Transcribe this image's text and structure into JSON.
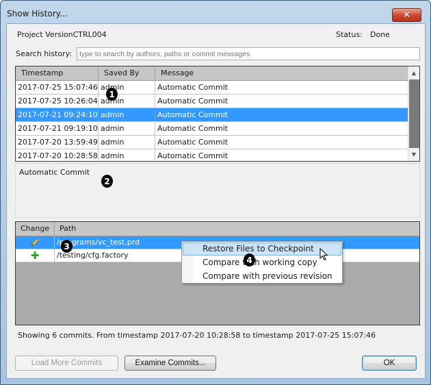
{
  "window": {
    "title": "Show History...",
    "close_icon": "close-x-icon"
  },
  "header": {
    "project": "Project VersionCTRL004",
    "status_label": "Status:",
    "status_value": "Done"
  },
  "search": {
    "label": "Search history:",
    "placeholder": "type to search by authors, paths or commit messages",
    "value": ""
  },
  "commits": {
    "columns": [
      "Timestamp",
      "Saved By",
      "Message"
    ],
    "selected_index": 2,
    "rows": [
      {
        "timestamp": "2017-07-25 15:07:46",
        "saved_by": "admin",
        "message": "Automatic Commit"
      },
      {
        "timestamp": "2017-07-25 10:26:04",
        "saved_by": "admin",
        "message": "Automatic Commit"
      },
      {
        "timestamp": "2017-07-21 09:24:10",
        "saved_by": "admin",
        "message": "Automatic Commit"
      },
      {
        "timestamp": "2017-07-21 09:19:10",
        "saved_by": "admin",
        "message": "Automatic Commit"
      },
      {
        "timestamp": "2017-07-20 13:59:49",
        "saved_by": "admin",
        "message": "Automatic Commit"
      },
      {
        "timestamp": "2017-07-20 10:28:58",
        "saved_by": "admin",
        "message": "Automatic Commit"
      }
    ]
  },
  "detail": {
    "message": "Automatic Commit"
  },
  "files": {
    "columns": [
      "Change",
      "Path"
    ],
    "selected_index": 0,
    "rows": [
      {
        "change": "modified",
        "change_icon": "pencil-icon",
        "path": "/programs/vc_test.prd"
      },
      {
        "change": "added",
        "change_icon": "plus-icon",
        "path": "/testing/cfg.factory"
      }
    ]
  },
  "context_menu": {
    "items": [
      {
        "label": "Restore Files to Checkpoint",
        "hovered": true
      },
      {
        "label": "Compare with working copy",
        "hovered": false
      },
      {
        "label": "Compare with previous revision",
        "hovered": false
      }
    ]
  },
  "summary": "Showing 6 commits. From timestamp 2017-07-20 10:28:58  to timestamp  2017-07-25 15:07:46",
  "buttons": {
    "load_more": "Load More Commits",
    "examine": "Examine Commits...",
    "ok": "OK"
  },
  "annotations": [
    "1",
    "2",
    "3",
    "4"
  ],
  "colors": {
    "selection": "#3399ff",
    "menu_hover": "#cce4f7",
    "added_green": "#21a821"
  }
}
